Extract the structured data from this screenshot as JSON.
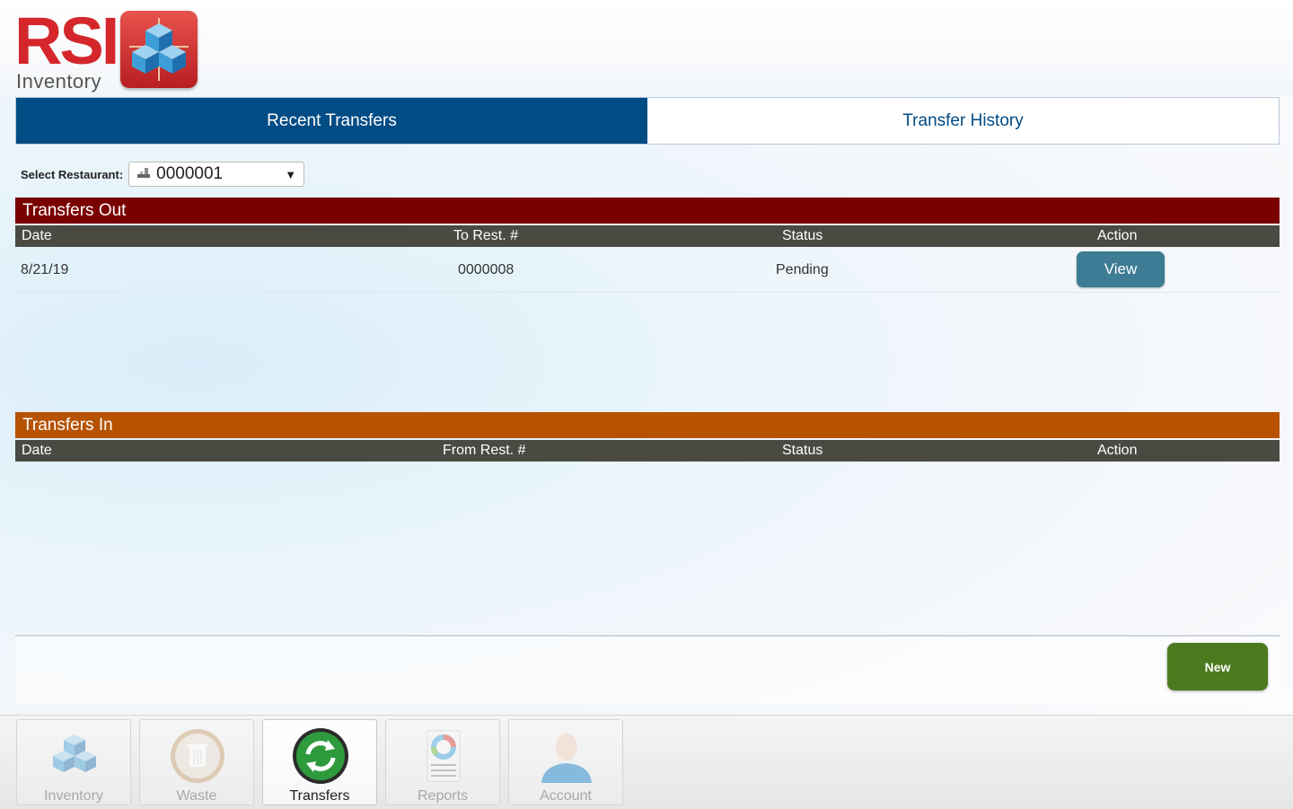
{
  "header": {
    "logo_text": "RSI",
    "logo_subtext": "Inventory"
  },
  "tabs": [
    {
      "label": "Recent Transfers",
      "active": true
    },
    {
      "label": "Transfer History",
      "active": false
    }
  ],
  "restaurant_select": {
    "label": "Select Restaurant:",
    "value": "0000001"
  },
  "transfers_out": {
    "title": "Transfers Out",
    "color": "#7a0000",
    "columns": [
      "Date",
      "To Rest. #",
      "Status",
      "Action"
    ],
    "rows": [
      {
        "date": "8/21/19",
        "rest": "0000008",
        "status": "Pending",
        "action": "View"
      }
    ]
  },
  "transfers_in": {
    "title": "Transfers In",
    "color": "#b65200",
    "columns": [
      "Date",
      "From Rest. #",
      "Status",
      "Action"
    ],
    "rows": []
  },
  "actions": {
    "new_label": "New"
  },
  "nav": [
    {
      "label": "Inventory",
      "icon": "cubes-icon",
      "active": false
    },
    {
      "label": "Waste",
      "icon": "trash-icon",
      "active": false
    },
    {
      "label": "Transfers",
      "icon": "transfer-arrows-icon",
      "active": true
    },
    {
      "label": "Reports",
      "icon": "report-chart-icon",
      "active": false
    },
    {
      "label": "Account",
      "icon": "user-icon",
      "active": false
    }
  ],
  "colors": {
    "tab_active": "#014c85",
    "column_bar": "#4a4a42",
    "view_button": "#3d7c94",
    "new_button": "#4c7a1f"
  }
}
